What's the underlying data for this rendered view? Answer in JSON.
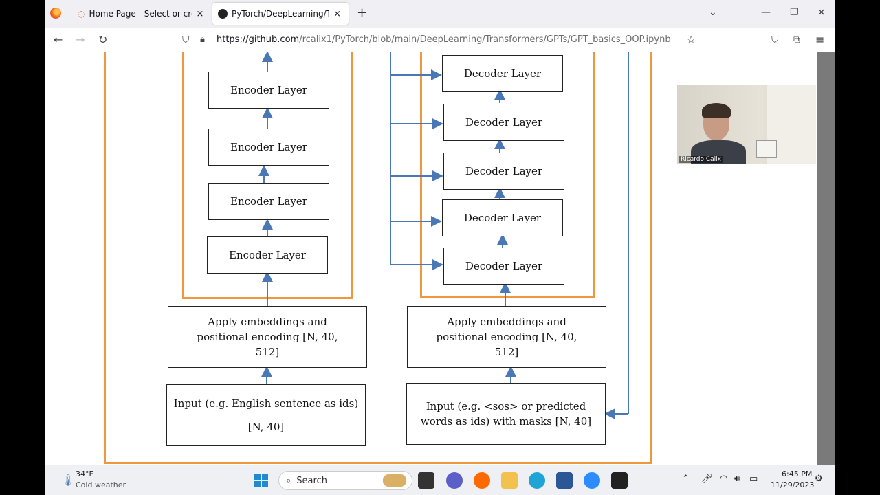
{
  "browser": {
    "tabs": [
      {
        "title": "Home Page - Select or create a",
        "active": false
      },
      {
        "title": "PyTorch/DeepLearning/Transfor",
        "active": true
      }
    ],
    "new_tab": "+",
    "close": "×",
    "url_host": "https://github.com",
    "url_path": "/rcalix1/PyTorch/blob/main/DeepLearning/Transformers/GPTs/GPT_basics_OOP.ipynb"
  },
  "diagram": {
    "encoder_layers": [
      "Encoder Layer",
      "Encoder Layer",
      "Encoder Layer",
      "Encoder Layer"
    ],
    "decoder_layers": [
      "Decoder Layer",
      "Decoder Layer",
      "Decoder Layer",
      "Decoder Layer",
      "Decoder Layer"
    ],
    "enc_embed": "Apply embeddings and positional encoding [N, 40, 512]",
    "dec_embed": "Apply embeddings and positional encoding [N, 40, 512]",
    "enc_input_1": "Input (e.g. English sentence as ids)",
    "enc_input_2": "[N, 40]",
    "dec_input": "Input (e.g. <sos> or predicted words as ids) with masks [N, 40]"
  },
  "webcam": {
    "name": "Ricardo Calix"
  },
  "taskbar": {
    "weather_temp": "34°F",
    "weather_desc": "Cold weather",
    "search": "Search",
    "time": "6:45 PM",
    "date": "11/29/2023"
  },
  "colors": {
    "accent": "#f0963c",
    "arrow": "#4a78b4"
  }
}
